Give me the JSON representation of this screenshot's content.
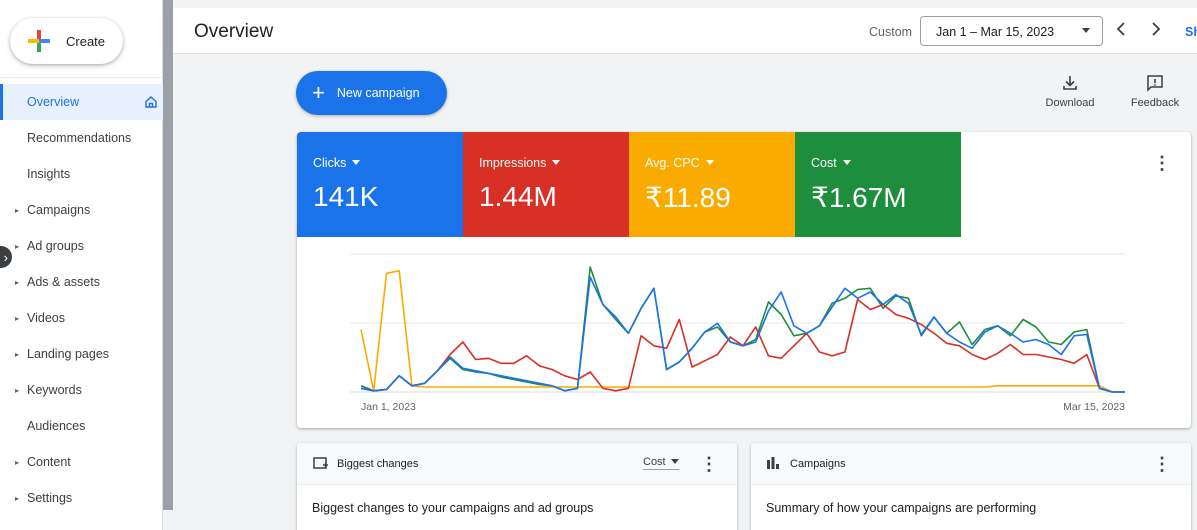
{
  "sidebar": {
    "create_label": "Create",
    "items": [
      {
        "label": "Overview",
        "active": true,
        "expandable": false
      },
      {
        "label": "Recommendations",
        "active": false,
        "expandable": false
      },
      {
        "label": "Insights",
        "active": false,
        "expandable": false
      },
      {
        "label": "Campaigns",
        "active": false,
        "expandable": true
      },
      {
        "label": "Ad groups",
        "active": false,
        "expandable": true
      },
      {
        "label": "Ads & assets",
        "active": false,
        "expandable": true
      },
      {
        "label": "Videos",
        "active": false,
        "expandable": true
      },
      {
        "label": "Landing pages",
        "active": false,
        "expandable": true
      },
      {
        "label": "Keywords",
        "active": false,
        "expandable": true
      },
      {
        "label": "Audiences",
        "active": false,
        "expandable": false
      },
      {
        "label": "Content",
        "active": false,
        "expandable": true
      },
      {
        "label": "Settings",
        "active": false,
        "expandable": true
      }
    ]
  },
  "header": {
    "title": "Overview",
    "custom_label": "Custom",
    "date_range": "Jan 1 – Mar 15, 2023",
    "show_label": "Sh"
  },
  "toolbar": {
    "new_campaign_label": "New campaign",
    "download_label": "Download",
    "feedback_label": "Feedback"
  },
  "metrics": [
    {
      "name": "Clicks",
      "value": "141K",
      "color": "#1a73e8"
    },
    {
      "name": "Impressions",
      "value": "1.44M",
      "color": "#d93025"
    },
    {
      "name": "Avg. CPC",
      "value": "₹11.89",
      "color": "#f9ab00"
    },
    {
      "name": "Cost",
      "value": "₹1.67M",
      "color": "#1e8e3e"
    }
  ],
  "chart_data": {
    "type": "line",
    "x_start_label": "Jan 1, 2023",
    "x_end_label": "Mar 15, 2023",
    "ylim": [
      0,
      100
    ],
    "grid": true,
    "series": [
      {
        "name": "Clicks",
        "color": "#1a73e8",
        "values": [
          3,
          1,
          2,
          13,
          5,
          7,
          17,
          28,
          19,
          17,
          15,
          13,
          11,
          9,
          7,
          5,
          1,
          3,
          92,
          70,
          60,
          47,
          67,
          83,
          18,
          24,
          35,
          48,
          55,
          40,
          37,
          40,
          65,
          80,
          53,
          47,
          53,
          68,
          83,
          75,
          80,
          70,
          78,
          71,
          46,
          60,
          47,
          40,
          35,
          48,
          53,
          47,
          40,
          42,
          38,
          30,
          45,
          46,
          3,
          0,
          0
        ]
      },
      {
        "name": "Impressions",
        "color": "#d93025",
        "values": [
          3,
          1,
          2,
          13,
          5,
          7,
          17,
          30,
          40,
          26,
          27,
          23,
          23,
          29,
          21,
          18,
          13,
          10,
          16,
          3,
          1,
          3,
          45,
          37,
          35,
          58,
          20,
          25,
          30,
          44,
          37,
          52,
          29,
          27,
          37,
          47,
          32,
          29,
          32,
          74,
          66,
          70,
          62,
          59,
          54,
          47,
          39,
          37,
          30,
          26,
          31,
          38,
          30,
          30,
          28,
          26,
          23,
          30,
          3,
          0,
          0
        ]
      },
      {
        "name": "Avg. CPC",
        "color": "#f9ab00",
        "values": [
          50,
          1,
          95,
          97,
          5,
          4,
          4,
          4,
          4,
          4,
          4,
          4,
          4,
          4,
          4,
          4,
          4,
          4,
          4,
          4,
          4,
          4,
          4,
          4,
          4,
          4,
          4,
          4,
          4,
          4,
          4,
          4,
          4,
          4,
          4,
          4,
          4,
          4,
          4,
          4,
          4,
          4,
          4,
          4,
          4,
          4,
          4,
          4,
          4,
          4,
          5,
          5,
          5,
          5,
          5,
          5,
          5,
          5,
          5,
          0,
          0
        ]
      },
      {
        "name": "Cost",
        "color": "#1e8e3e",
        "values": [
          5,
          1,
          2,
          13,
          5,
          7,
          17,
          27,
          18,
          16,
          15,
          12,
          10,
          8,
          6,
          5,
          1,
          3,
          100,
          70,
          58,
          47,
          67,
          83,
          18,
          24,
          35,
          48,
          52,
          40,
          37,
          42,
          72,
          62,
          45,
          47,
          53,
          71,
          75,
          82,
          83,
          67,
          77,
          75,
          45,
          60,
          47,
          56,
          38,
          50,
          53,
          45,
          58,
          52,
          40,
          38,
          48,
          50,
          3,
          0,
          0
        ]
      }
    ]
  },
  "cards": {
    "changes": {
      "title": "Biggest changes",
      "sort_label": "Cost",
      "subtitle": "Biggest changes to your campaigns and ad groups"
    },
    "campaigns": {
      "title": "Campaigns",
      "subtitle": "Summary of how your campaigns are performing"
    }
  }
}
